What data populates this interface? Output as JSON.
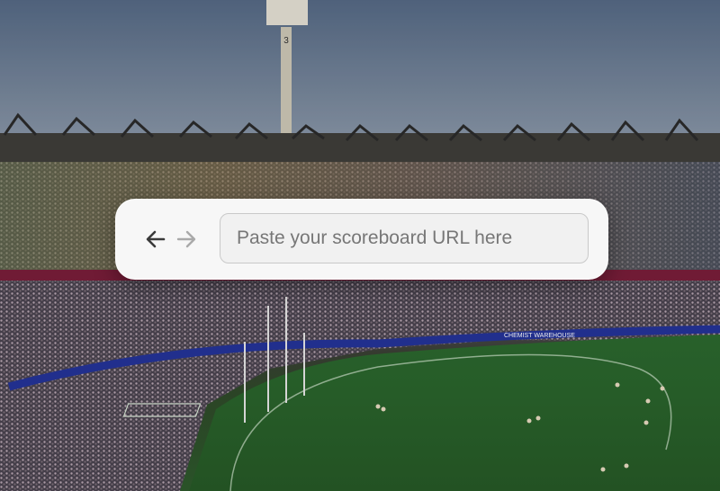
{
  "browser": {
    "back_icon": "arrow-left-icon",
    "forward_icon": "arrow-right-icon",
    "url_value": "",
    "url_placeholder": "Paste your scoreboard URL here"
  },
  "scene": {
    "floodlight_number": "3",
    "signage_text": "CHEMIST WAREHOUSE",
    "sky_color": "#6f8098",
    "grass_color": "#2f5a2c"
  }
}
